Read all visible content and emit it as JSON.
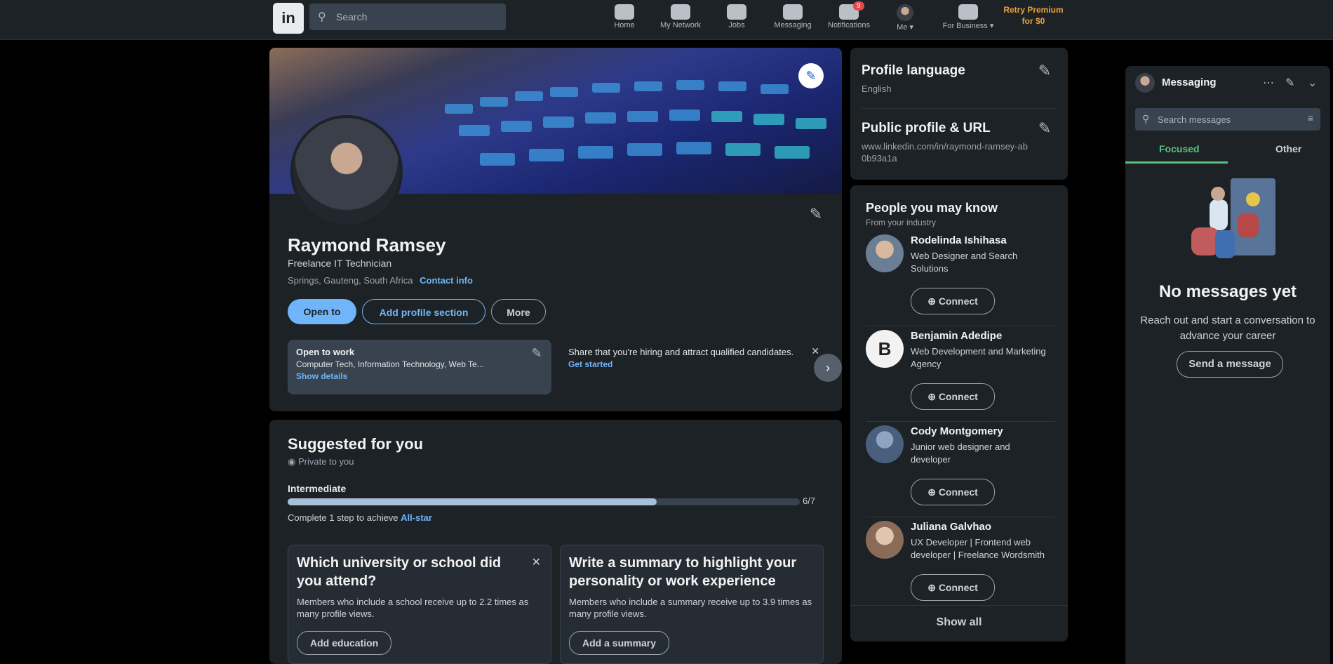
{
  "nav": {
    "search_placeholder": "Search",
    "items": [
      {
        "label": "Home"
      },
      {
        "label": "My Network"
      },
      {
        "label": "Jobs"
      },
      {
        "label": "Messaging"
      },
      {
        "label": "Notifications",
        "badge": "9"
      },
      {
        "label": "Me ▾"
      },
      {
        "label": "For Business ▾"
      }
    ],
    "premium": "Retry Premium for $0"
  },
  "profile": {
    "name": "Raymond Ramsey",
    "headline": "Freelance IT Technician",
    "location": "Springs, Gauteng, South Africa",
    "contact_info": "Contact info",
    "buttons": {
      "open_to": "Open to",
      "add_section": "Add profile section",
      "more": "More"
    },
    "open_to_work": {
      "title": "Open to work",
      "roles": "Computer Tech, Information Technology, Web Te...",
      "link": "Show details"
    },
    "hiring": {
      "text": "Share that you're hiring and attract qualified candidates.",
      "link": "Get started"
    }
  },
  "suggested": {
    "title": "Suggested for you",
    "subtitle": "Private to you",
    "level": "Intermediate",
    "progress_label": "6/7",
    "progress_fraction": 0.72,
    "note": "Complete 1 step to achieve",
    "note_link": "All-star",
    "cards": [
      {
        "question": "Which university or school did you attend?",
        "desc": "Members who include a school receive up to 2.2 times as many profile views.",
        "button": "Add education"
      },
      {
        "question": "Write a summary to highlight your personality or work experience",
        "desc": "Members who include a summary receive up to 3.9 times as many profile views.",
        "button": "Add a summary"
      }
    ]
  },
  "right": {
    "profile_language": {
      "title": "Profile language",
      "value": "English"
    },
    "public_profile": {
      "title": "Public profile & URL",
      "value": "www.linkedin.com/in/raymond-ramsey-ab0b93a1a"
    },
    "pymk": {
      "title": "People you may know",
      "subtitle": "From your industry",
      "people": [
        {
          "name": "Rodelinda Ishihasa",
          "desc": "Web Designer and Search Solutions",
          "button": "Connect"
        },
        {
          "name": "Benjamin Adedipe",
          "desc": "Web Development and Marketing Agency",
          "button": "Connect"
        },
        {
          "name": "Cody Montgomery",
          "desc": "Junior web designer and developer",
          "button": "Connect"
        },
        {
          "name": "Juliana Galvhao",
          "desc": "UX Developer | Frontend web developer | Freelance Wordsmith",
          "button": "Connect"
        }
      ],
      "show_all": "Show all"
    }
  },
  "messaging": {
    "title": "Messaging",
    "search_placeholder": "Search messages",
    "tabs": [
      "Focused",
      "Other"
    ],
    "empty_title": "No messages yet",
    "empty_desc": "Reach out and start a conversation to advance your career",
    "button": "Send a message"
  },
  "colors": {
    "accent": "#70b5f9",
    "surface": "#1d2226",
    "green": "#57c27a"
  }
}
